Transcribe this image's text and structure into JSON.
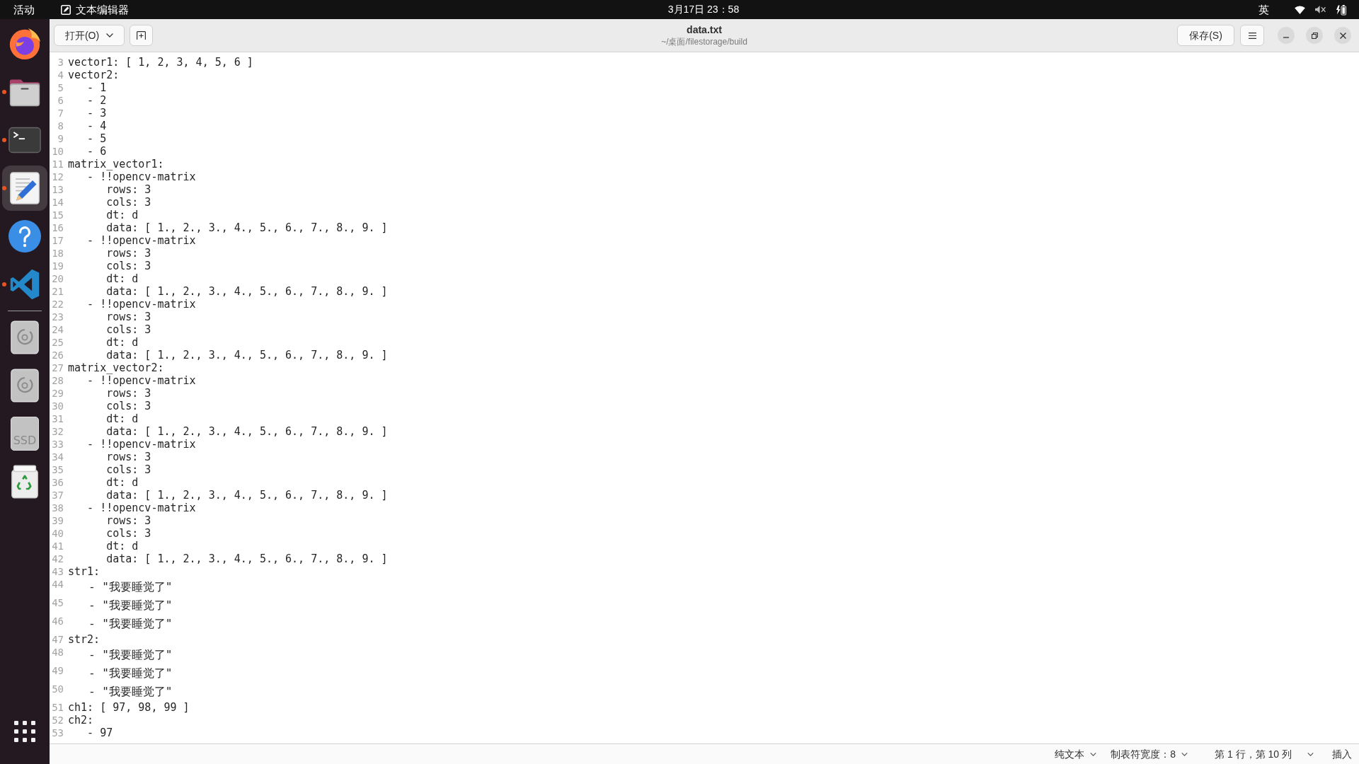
{
  "top_bar": {
    "activities": "活动",
    "app_name": "文本编辑器",
    "clock": "3月17日 23：58",
    "input_method": "英"
  },
  "dock": {
    "apps": [
      {
        "kind": "browser",
        "running": false,
        "selected": false
      },
      {
        "kind": "files",
        "running": true,
        "selected": false
      },
      {
        "kind": "terminal",
        "running": true,
        "selected": false
      },
      {
        "kind": "editor",
        "running": true,
        "selected": true
      },
      {
        "kind": "help",
        "running": false,
        "selected": false
      },
      {
        "kind": "code",
        "running": true,
        "selected": false
      }
    ],
    "volumes": [
      {
        "kind": "disc"
      },
      {
        "kind": "disc"
      },
      {
        "kind": "drive",
        "label": "SSD"
      },
      {
        "kind": "trash"
      }
    ]
  },
  "header": {
    "open_button": "打开(O)",
    "title": "data.txt",
    "subtitle": "~/桌面/filestorage/build",
    "save_button": "保存(S)"
  },
  "editor": {
    "lines": [
      {
        "number": "3",
        "kind": "plain",
        "text": "vector1: [ 1, 2, 3, 4, 5, 6 ]"
      },
      {
        "number": "4",
        "kind": "plain",
        "text": "vector2:"
      },
      {
        "number": "5",
        "kind": "plain",
        "text": "   - 1"
      },
      {
        "number": "6",
        "kind": "plain",
        "text": "   - 2"
      },
      {
        "number": "7",
        "kind": "plain",
        "text": "   - 3"
      },
      {
        "number": "8",
        "kind": "plain",
        "text": "   - 4"
      },
      {
        "number": "9",
        "kind": "plain",
        "text": "   - 5"
      },
      {
        "number": "10",
        "kind": "plain",
        "text": "   - 6"
      },
      {
        "number": "11",
        "kind": "plain",
        "text": "matrix_vector1:"
      },
      {
        "number": "12",
        "kind": "plain",
        "text": "   - !!opencv-matrix"
      },
      {
        "number": "13",
        "kind": "plain",
        "text": "      rows: 3"
      },
      {
        "number": "14",
        "kind": "plain",
        "text": "      cols: 3"
      },
      {
        "number": "15",
        "kind": "plain",
        "text": "      dt: d"
      },
      {
        "number": "16",
        "kind": "plain",
        "text": "      data: [ 1., 2., 3., 4., 5., 6., 7., 8., 9. ]"
      },
      {
        "number": "17",
        "kind": "plain",
        "text": "   - !!opencv-matrix"
      },
      {
        "number": "18",
        "kind": "plain",
        "text": "      rows: 3"
      },
      {
        "number": "19",
        "kind": "plain",
        "text": "      cols: 3"
      },
      {
        "number": "20",
        "kind": "plain",
        "text": "      dt: d"
      },
      {
        "number": "21",
        "kind": "plain",
        "text": "      data: [ 1., 2., 3., 4., 5., 6., 7., 8., 9. ]"
      },
      {
        "number": "22",
        "kind": "plain",
        "text": "   - !!opencv-matrix"
      },
      {
        "number": "23",
        "kind": "plain",
        "text": "      rows: 3"
      },
      {
        "number": "24",
        "kind": "plain",
        "text": "      cols: 3"
      },
      {
        "number": "25",
        "kind": "plain",
        "text": "      dt: d"
      },
      {
        "number": "26",
        "kind": "plain",
        "text": "      data: [ 1., 2., 3., 4., 5., 6., 7., 8., 9. ]"
      },
      {
        "number": "27",
        "kind": "plain",
        "text": "matrix_vector2:"
      },
      {
        "number": "28",
        "kind": "plain",
        "text": "   - !!opencv-matrix"
      },
      {
        "number": "29",
        "kind": "plain",
        "text": "      rows: 3"
      },
      {
        "number": "30",
        "kind": "plain",
        "text": "      cols: 3"
      },
      {
        "number": "31",
        "kind": "plain",
        "text": "      dt: d"
      },
      {
        "number": "32",
        "kind": "plain",
        "text": "      data: [ 1., 2., 3., 4., 5., 6., 7., 8., 9. ]"
      },
      {
        "number": "33",
        "kind": "plain",
        "text": "   - !!opencv-matrix"
      },
      {
        "number": "34",
        "kind": "plain",
        "text": "      rows: 3"
      },
      {
        "number": "35",
        "kind": "plain",
        "text": "      cols: 3"
      },
      {
        "number": "36",
        "kind": "plain",
        "text": "      dt: d"
      },
      {
        "number": "37",
        "kind": "plain",
        "text": "      data: [ 1., 2., 3., 4., 5., 6., 7., 8., 9. ]"
      },
      {
        "number": "38",
        "kind": "plain",
        "text": "   - !!opencv-matrix"
      },
      {
        "number": "39",
        "kind": "plain",
        "text": "      rows: 3"
      },
      {
        "number": "40",
        "kind": "plain",
        "text": "      cols: 3"
      },
      {
        "number": "41",
        "kind": "plain",
        "text": "      dt: d"
      },
      {
        "number": "42",
        "kind": "plain",
        "text": "      data: [ 1., 2., 3., 4., 5., 6., 7., 8., 9. ]"
      },
      {
        "number": "43",
        "kind": "plain",
        "text": "str1:"
      },
      {
        "number": "44",
        "kind": "cjk",
        "text": "   - \"我要睡觉了\""
      },
      {
        "number": "45",
        "kind": "cjk",
        "text": "   - \"我要睡觉了\""
      },
      {
        "number": "46",
        "kind": "cjk",
        "text": "   - \"我要睡觉了\""
      },
      {
        "number": "47",
        "kind": "plain",
        "text": "str2:"
      },
      {
        "number": "48",
        "kind": "cjk",
        "text": "   - \"我要睡觉了\""
      },
      {
        "number": "49",
        "kind": "cjk",
        "text": "   - \"我要睡觉了\""
      },
      {
        "number": "50",
        "kind": "cjk",
        "text": "   - \"我要睡觉了\""
      },
      {
        "number": "51",
        "kind": "plain",
        "text": "ch1: [ 97, 98, 99 ]"
      },
      {
        "number": "52",
        "kind": "plain",
        "text": "ch2:"
      },
      {
        "number": "53",
        "kind": "plain",
        "text": "   - 97"
      }
    ]
  },
  "status_bar": {
    "language": "纯文本",
    "tab_width": "制表符宽度：8",
    "cursor_position": "第 1 行，第 10 列",
    "input_mode": "插入"
  }
}
